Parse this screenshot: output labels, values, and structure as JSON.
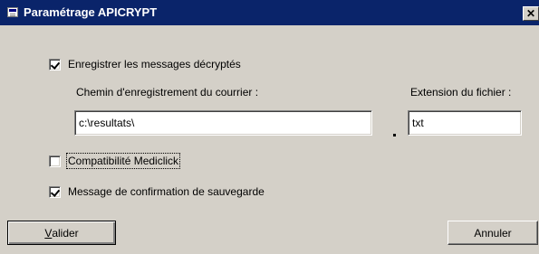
{
  "window": {
    "title": "Paramétrage APICRYPT",
    "close_glyph": "✕"
  },
  "options": {
    "save_decrypted": {
      "label": "Enregistrer les messages décryptés",
      "checked": true
    },
    "mediclick": {
      "label": "Compatibilité Mediclick",
      "checked": false
    },
    "confirm_save": {
      "label": "Message de confirmation de sauvegarde",
      "checked": true
    }
  },
  "path_field": {
    "label": "Chemin d'enregistrement du courrier :",
    "value": "c:\\resultats\\"
  },
  "extension_field": {
    "label": "Extension du fichier :",
    "value": "txt"
  },
  "buttons": {
    "validate": {
      "mnemonic": "V",
      "rest": "alider"
    },
    "cancel": {
      "label": "Annuler"
    }
  },
  "icons": {
    "app": "app-window-icon",
    "close": "close-icon"
  }
}
